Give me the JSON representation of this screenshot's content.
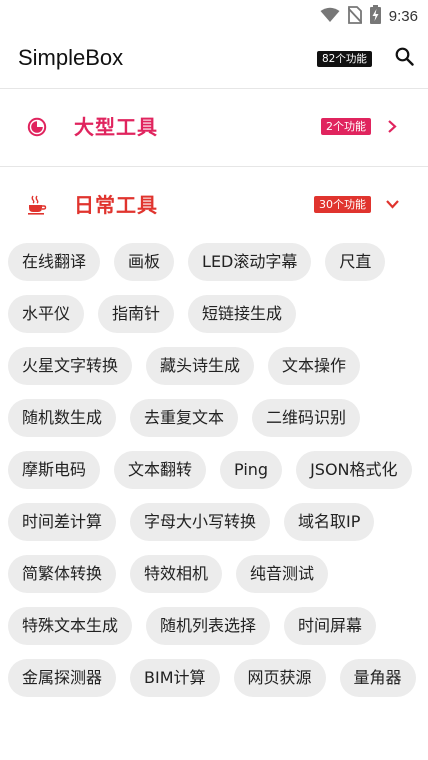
{
  "status_bar": {
    "time": "9:36",
    "icons": [
      "wifi-icon",
      "no-sim-icon",
      "battery-charging-icon"
    ]
  },
  "app_bar": {
    "title": "SimpleBox",
    "count_badge": "82个功能",
    "search_icon": "search-icon"
  },
  "categories": [
    {
      "name": "大型工具",
      "badge": "2个功能",
      "icon": "pie-chart-icon",
      "arrow": "chevron-right-icon",
      "badge_color": "#e0245e"
    },
    {
      "name": "日常工具",
      "badge": "30个功能",
      "icon": "coffee-cup-icon",
      "arrow": "chevron-down-icon",
      "badge_color": "#e0342e"
    }
  ],
  "tools": [
    "在线翻译",
    "画板",
    "LED滚动字幕",
    "尺直",
    "水平仪",
    "指南针",
    "短链接生成",
    "火星文字转换",
    "藏头诗生成",
    "文本操作",
    "随机数生成",
    "去重复文本",
    "二维码识别",
    "摩斯电码",
    "文本翻转",
    "Ping",
    "JSON格式化",
    "时间差计算",
    "字母大小写转换",
    "域名取IP",
    "简繁体转换",
    "特效相机",
    "纯音测试",
    "特殊文本生成",
    "随机列表选择",
    "时间屏幕",
    "金属探测器",
    "BIM计算",
    "网页获源",
    "量角器"
  ],
  "colors": {
    "accent": "#e0245e",
    "accent_red": "#e0342e",
    "chip_bg": "#ececec"
  }
}
